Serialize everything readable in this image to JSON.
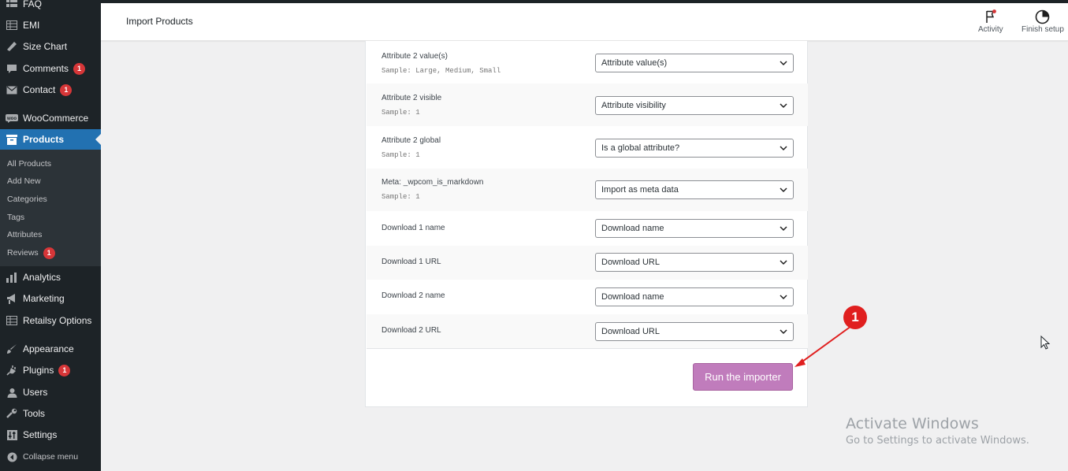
{
  "sidebar": {
    "items": [
      {
        "label": "FAQ",
        "icon": "faq-icon",
        "badge": ""
      },
      {
        "label": "EMI",
        "icon": "table-icon",
        "badge": ""
      },
      {
        "label": "Size Chart",
        "icon": "ruler-icon",
        "badge": ""
      },
      {
        "label": "Comments",
        "icon": "comment-icon",
        "badge": "1"
      },
      {
        "label": "Contact",
        "icon": "mail-icon",
        "badge": "1"
      },
      {
        "label": "WooCommerce",
        "icon": "woo-icon",
        "badge": ""
      },
      {
        "label": "Products",
        "icon": "archive-icon",
        "badge": ""
      },
      {
        "label": "Analytics",
        "icon": "chart-icon",
        "badge": ""
      },
      {
        "label": "Marketing",
        "icon": "megaphone-icon",
        "badge": ""
      },
      {
        "label": "Retailsy Options",
        "icon": "table-icon",
        "badge": ""
      },
      {
        "label": "Appearance",
        "icon": "brush-icon",
        "badge": ""
      },
      {
        "label": "Plugins",
        "icon": "plug-icon",
        "badge": "1"
      },
      {
        "label": "Users",
        "icon": "user-icon",
        "badge": ""
      },
      {
        "label": "Tools",
        "icon": "wrench-icon",
        "badge": ""
      },
      {
        "label": "Settings",
        "icon": "settings-icon",
        "badge": ""
      },
      {
        "label": "Collapse menu",
        "icon": "collapse-icon",
        "badge": ""
      }
    ],
    "submenu": [
      {
        "label": "All Products",
        "badge": ""
      },
      {
        "label": "Add New",
        "badge": ""
      },
      {
        "label": "Categories",
        "badge": ""
      },
      {
        "label": "Tags",
        "badge": ""
      },
      {
        "label": "Attributes",
        "badge": ""
      },
      {
        "label": "Reviews",
        "badge": "1"
      }
    ]
  },
  "header": {
    "title": "Import Products",
    "activity": "Activity",
    "finish_setup": "Finish setup"
  },
  "mapping": {
    "rows": [
      {
        "label": "Attribute 2 value(s)",
        "sample": "Sample: Large, Medium, Small",
        "select": "Attribute value(s)"
      },
      {
        "label": "Attribute 2 visible",
        "sample": "Sample: 1",
        "select": "Attribute visibility"
      },
      {
        "label": "Attribute 2 global",
        "sample": "Sample: 1",
        "select": "Is a global attribute?"
      },
      {
        "label": "Meta: _wpcom_is_markdown",
        "sample": "Sample: 1",
        "select": "Import as meta data"
      },
      {
        "label": "Download 1 name",
        "sample": "",
        "select": "Download name"
      },
      {
        "label": "Download 1 URL",
        "sample": "",
        "select": "Download URL"
      },
      {
        "label": "Download 2 name",
        "sample": "",
        "select": "Download name"
      },
      {
        "label": "Download 2 URL",
        "sample": "",
        "select": "Download URL"
      }
    ],
    "run_button": "Run the importer"
  },
  "annotation": {
    "number": "1"
  },
  "watermark": {
    "title": "Activate Windows",
    "subtitle": "Go to Settings to activate Windows."
  },
  "colors": {
    "sidebar_bg": "#1d2327",
    "active_menu": "#2271b1",
    "button": "#c07cbc",
    "badge": "#d63638",
    "annotation": "#e01f1f"
  }
}
